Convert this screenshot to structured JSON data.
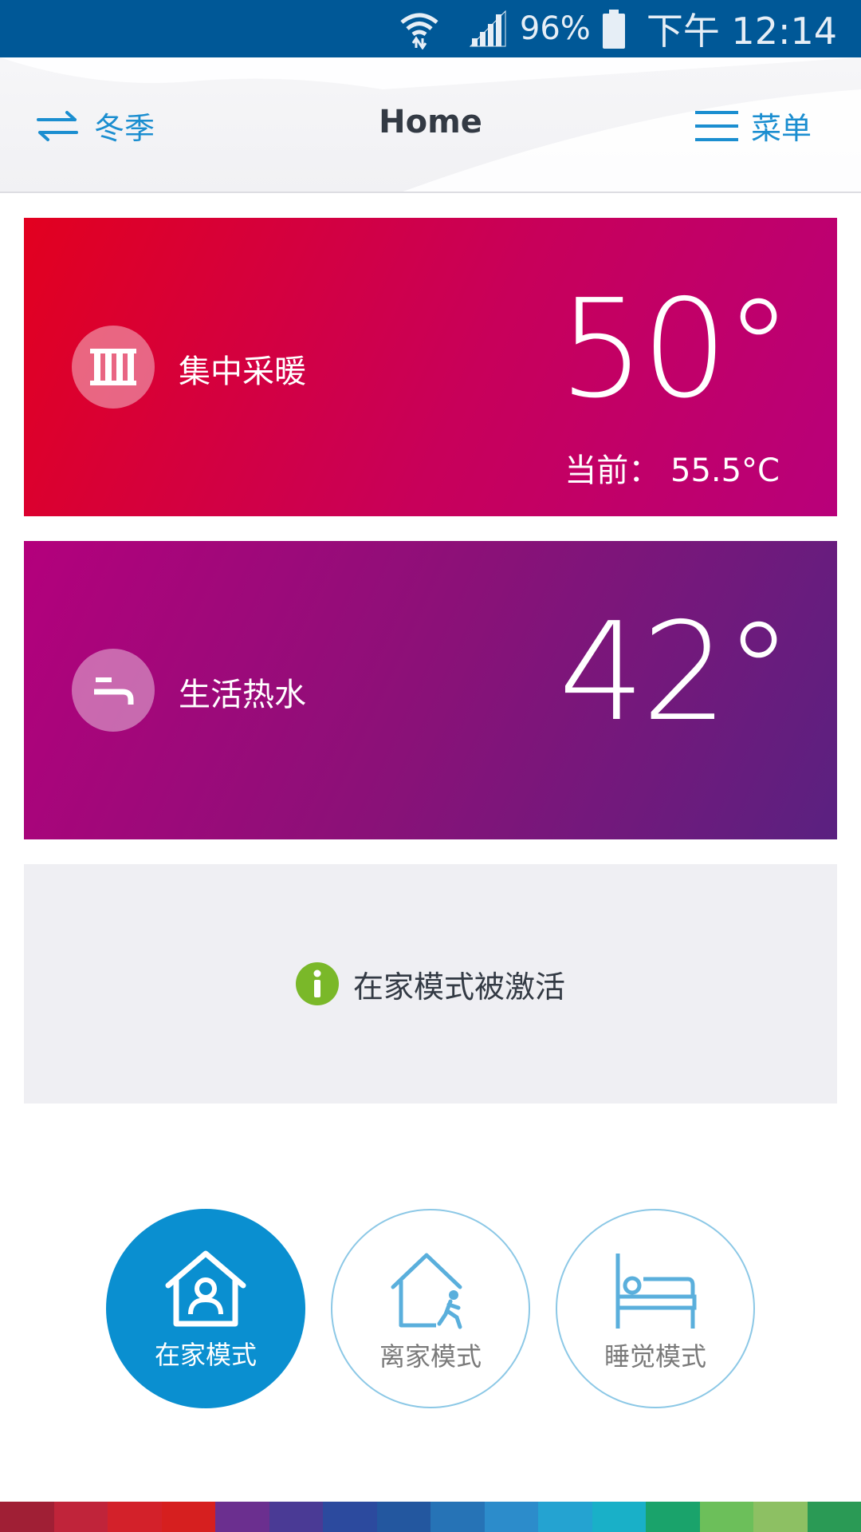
{
  "status_bar": {
    "battery": "96%",
    "time": "下午 12:14"
  },
  "header": {
    "season_label": "冬季",
    "title": "Home",
    "menu_label": "菜单"
  },
  "heating": {
    "label": "集中采暖",
    "setpoint": "50°",
    "current": "当前： 55.5°C"
  },
  "hot_water": {
    "label": "生活热水",
    "setpoint": "42°"
  },
  "info": {
    "message": "在家模式被激活"
  },
  "modes": {
    "home": "在家模式",
    "away": "离家模式",
    "sleep": "睡觉模式",
    "active": "home"
  },
  "colors": {
    "status_bar": "#005897",
    "accent": "#1b8ed0",
    "heating_start": "#e2001f",
    "heating_end": "#b8007a",
    "water_start": "#b4007c",
    "water_end": "#5a2180",
    "info_icon": "#7ab829",
    "active_mode": "#0a8fd0"
  },
  "strip_colors": [
    "#a01f35",
    "#c0243a",
    "#d3212a",
    "#d61f1f",
    "#6b2f8f",
    "#4a3a95",
    "#2c4a9e",
    "#23579f",
    "#2673b6",
    "#2c8ccb",
    "#24a3d1",
    "#19b0c8",
    "#1aa36b",
    "#6cbf5a",
    "#8dc063",
    "#2a9a55"
  ]
}
